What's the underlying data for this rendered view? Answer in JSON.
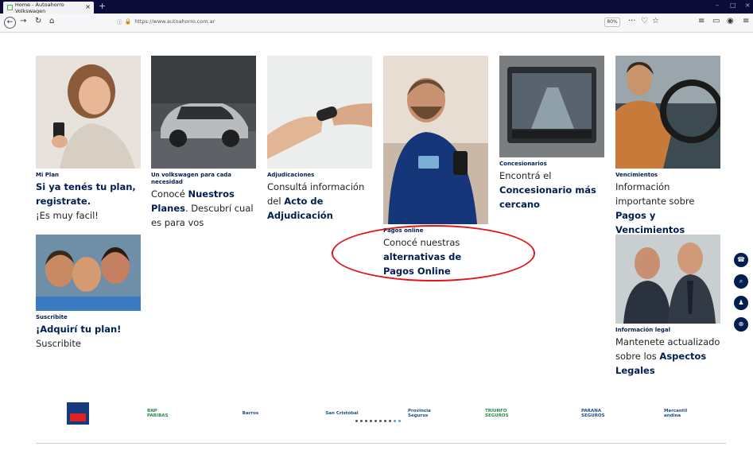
{
  "browser": {
    "tab_title": "Home - Autoahorro Volkswagen",
    "new_tab": "+",
    "url": "https://www.autoahorro.com.ar",
    "zoom": "80%"
  },
  "cards": [
    {
      "label": "Mi Plan",
      "body": "<b>Si ya tenés tu plan, registrate.</b><br>¡Es muy facil!"
    },
    {
      "label": "Un volkswagen para cada necesidad",
      "body": "Conocé <b>Nuestros Planes</b>. Descubrí cual es para vos"
    },
    {
      "label": "Adjudicaciones",
      "body": "Consultá información del <b>Acto de Adjudicación</b>"
    },
    {
      "label": "Pagos online",
      "body": "Conocé nuestras <b>alternativas de Pagos Online</b>"
    },
    {
      "label": "Concesionarios",
      "body": "Encontrá el <b>Concesionario más cercano</b>"
    },
    {
      "label": "Vencimientos",
      "body": "Información importante sobre <b>Pagos y Vencimientos</b>"
    },
    {
      "label": "Suscribite",
      "body": "<b>¡Adquirí tu plan!</b><br>Suscribite"
    },
    {
      "label": "Información legal",
      "body": "Mantenete actualizado sobre los <b>Aspectos Legales</b>"
    }
  ],
  "partners": [
    "CAJA",
    "BNP PARIBAS",
    "Barros",
    "San Cristóbal",
    "Provincia Seguros",
    "TRIUNFO SEGUROS",
    "PARANA SEGUROS",
    "Mercantil andina"
  ],
  "tools": [
    "phone-icon",
    "search-icon",
    "user-icon",
    "cart-icon"
  ],
  "colors": {
    "brand": "#001e50",
    "highlight": "#e0141a",
    "active_dot": "#4fa0d8"
  }
}
